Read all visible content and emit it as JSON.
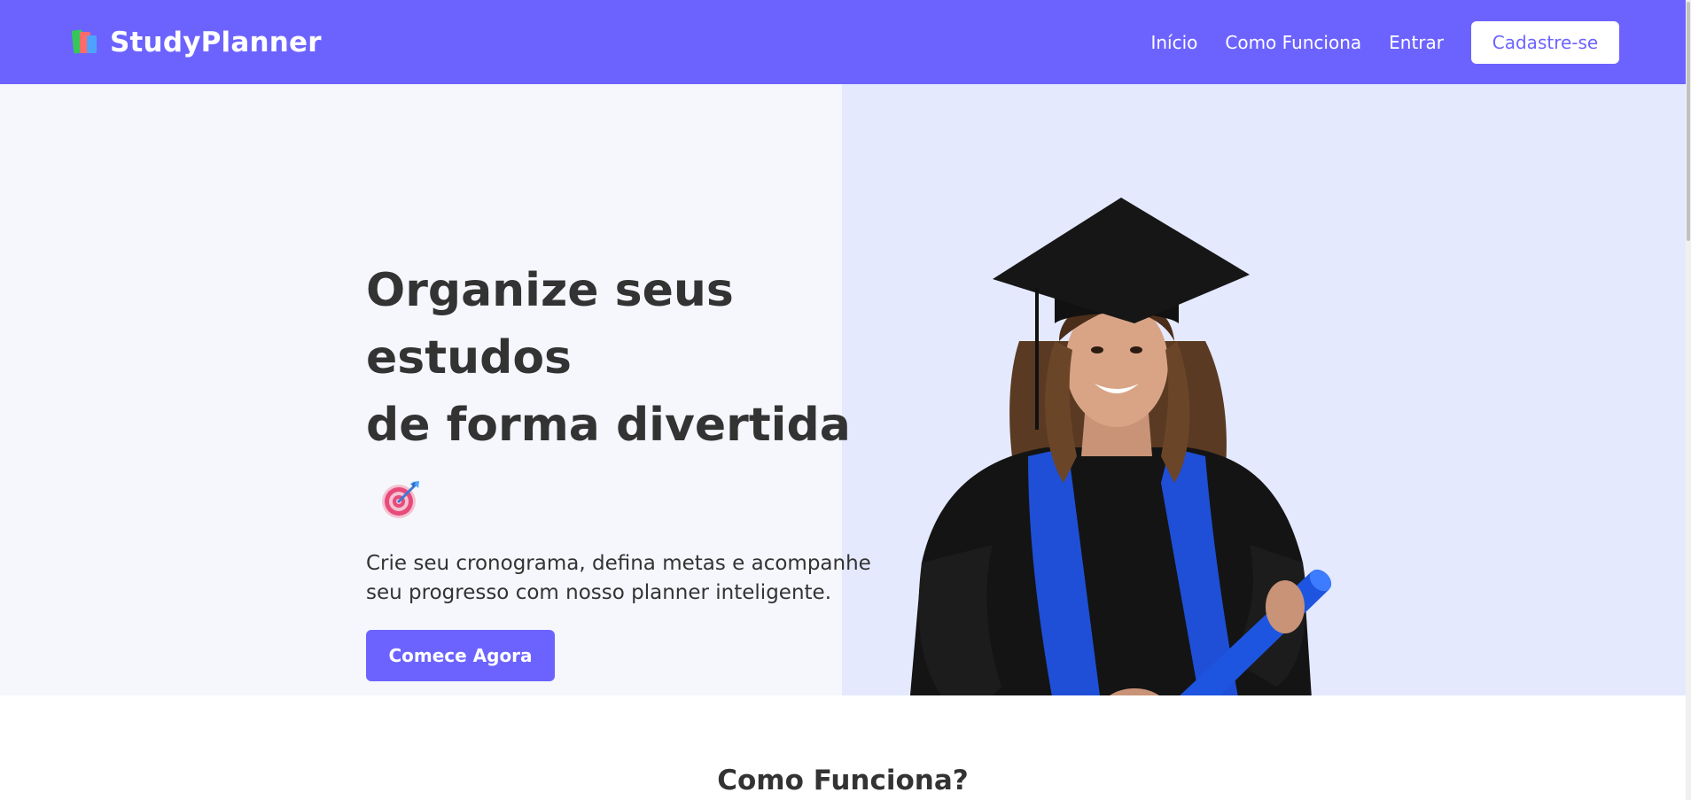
{
  "header": {
    "brand_name": "StudyPlanner",
    "nav": {
      "home": "Início",
      "how_it_works": "Como Funciona",
      "login": "Entrar",
      "signup": "Cadastre-se"
    }
  },
  "hero": {
    "title_line1": "Organize seus estudos",
    "title_line2": "de forma divertida",
    "title_icon": "target-icon",
    "subtitle": "Crie seu cronograma, defina metas e acompanhe seu progresso com nosso planner inteligente.",
    "cta_label": "Comece Agora"
  },
  "section_how": {
    "title": "Como Funciona?"
  },
  "colors": {
    "brand": "#6c63ff",
    "hero_bg_left": "#f5f7fc",
    "hero_bg_right": "#e4e9fe",
    "text": "#333333"
  }
}
